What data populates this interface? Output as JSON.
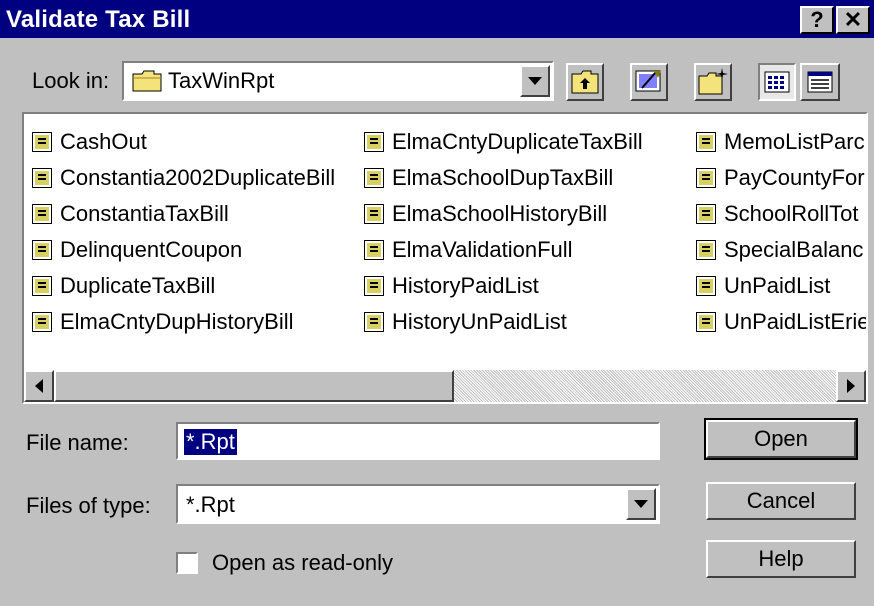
{
  "dialog": {
    "title": "Validate Tax Bill",
    "help_button": "?",
    "close_button": "✕"
  },
  "look_in": {
    "label": "Look in:",
    "value": "TaxWinRpt",
    "folder_icon": "folder-icon"
  },
  "toolbar": {
    "up_icon": "up-one-level-icon",
    "desktop_icon": "desktop-icon",
    "new_folder_icon": "new-folder-icon",
    "list_view_icon": "list-view-icon",
    "details_view_icon": "details-view-icon"
  },
  "files": {
    "icon": "report-file-icon",
    "columns": [
      [
        "CashOut",
        "Constantia2002DuplicateBill",
        "ConstantiaTaxBill",
        "DelinquentCoupon",
        "DuplicateTaxBill",
        "ElmaCntyDupHistoryBill"
      ],
      [
        "ElmaCntyDuplicateTaxBill",
        "ElmaSchoolDupTaxBill",
        "ElmaSchoolHistoryBill",
        "ElmaValidationFull",
        "HistoryPaidList",
        "HistoryUnPaidList"
      ],
      [
        "MemoListParc",
        "PayCountyFor",
        "SchoolRollTot",
        "SpecialBalanc",
        "UnPaidList",
        "UnPaidListErie"
      ]
    ]
  },
  "file_name": {
    "label": "File name:",
    "value": "*.Rpt"
  },
  "files_of_type": {
    "label": "Files of type:",
    "value": "*.Rpt"
  },
  "read_only": {
    "label": "Open as read-only",
    "checked": false
  },
  "buttons": {
    "open": "Open",
    "cancel": "Cancel",
    "help": "Help"
  },
  "colors": {
    "titlebar": "#000080",
    "face": "#c0c0c0",
    "selection": "#000080"
  }
}
